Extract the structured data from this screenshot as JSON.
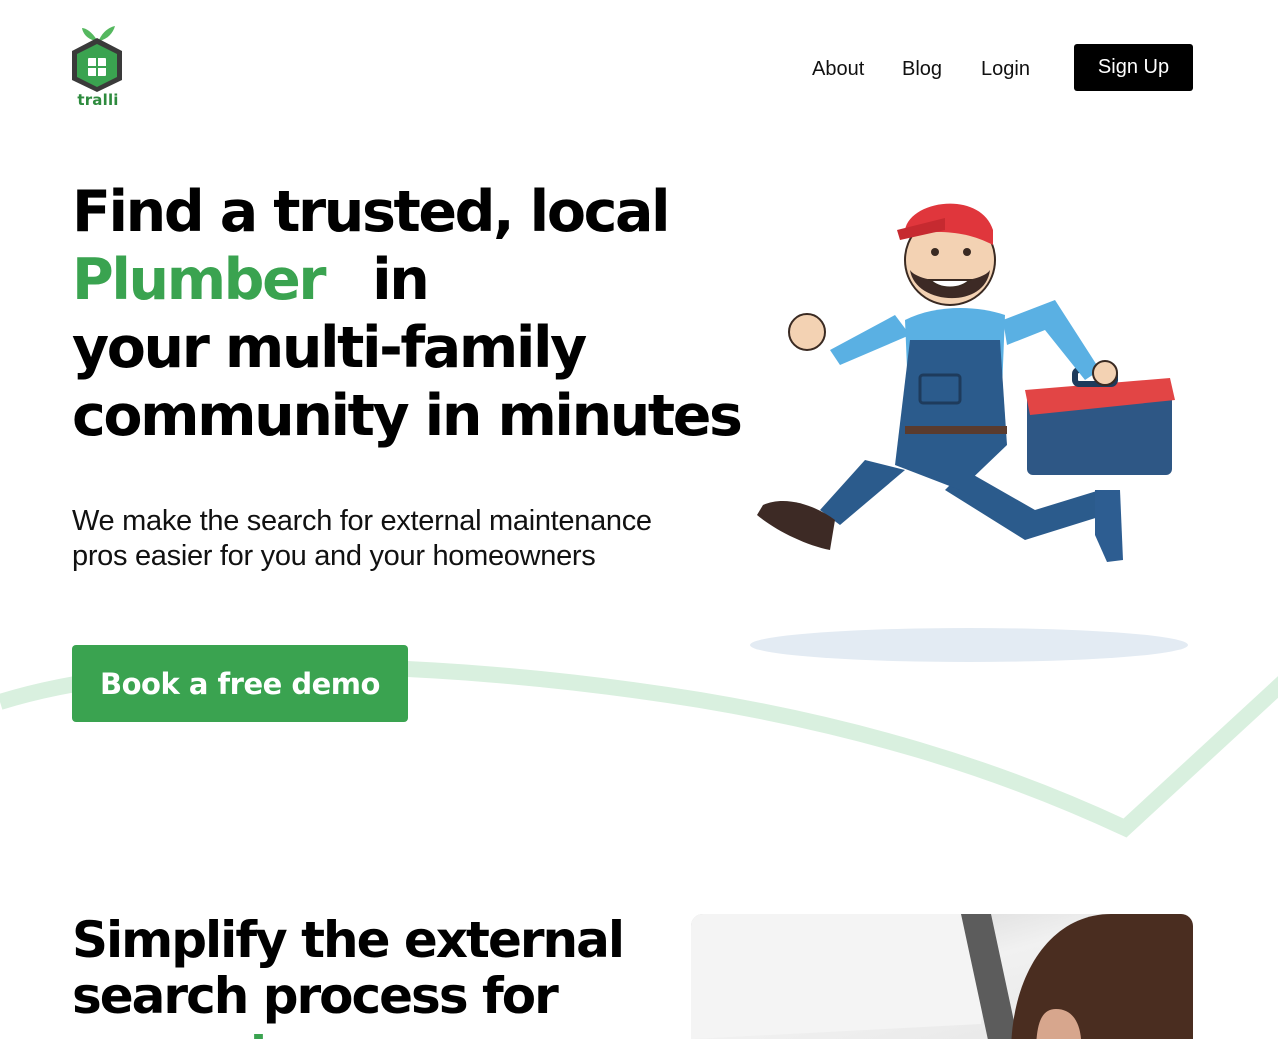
{
  "brand": {
    "name": "tralli",
    "color": "#2e8b3e"
  },
  "nav": {
    "items": [
      {
        "label": "About"
      },
      {
        "label": "Blog"
      },
      {
        "label": "Login"
      }
    ],
    "signup_label": "Sign Up"
  },
  "hero": {
    "title_line1": "Find a trusted, local",
    "title_accent": "Plumber",
    "title_line2_rest": "in",
    "title_line3": "your multi-family",
    "title_line4": "community in minutes",
    "subtitle_line1": "We make the search for external maintenance",
    "subtitle_line2": "pros easier for you and your homeowners",
    "cta_label": "Book a free demo",
    "illustration": "running-plumber-with-toolbox"
  },
  "section2": {
    "title_line1": "Simplify the external",
    "title_line2": "search process for",
    "title_line3_partial": "property  managers",
    "image": "woman-on-phone-under-sink"
  },
  "colors": {
    "accent": "#3aa350",
    "swoosh": "#d9f0df",
    "button_dark": "#000000"
  }
}
